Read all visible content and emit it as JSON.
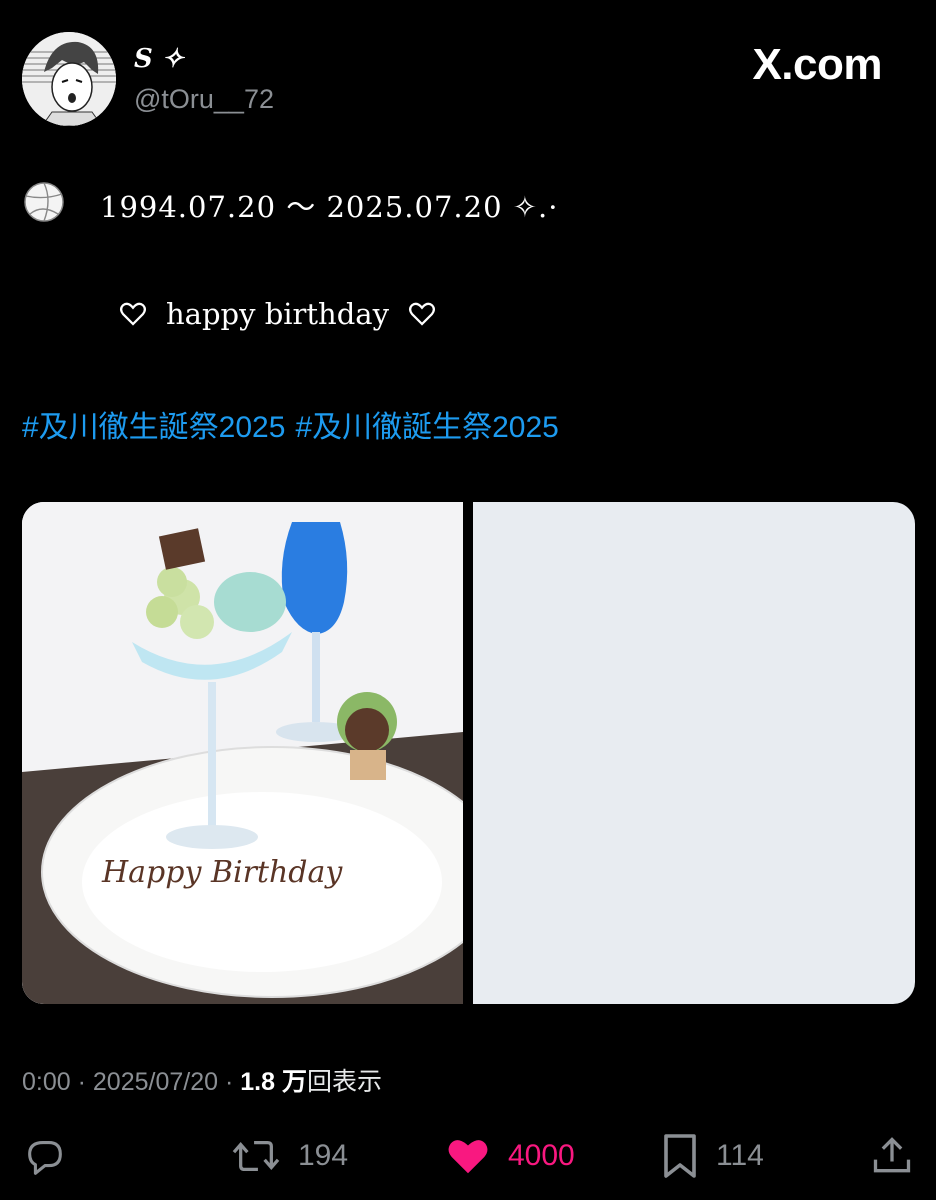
{
  "post": {
    "display_name": "S ✧",
    "handle": "@tOru__72",
    "brand": "X.com",
    "dates_line": "1994.07.20 〜 2025.07.20 ✧.·",
    "birthday_line": "happy birthday",
    "hashtags": [
      "#及川徹生誕祭2025",
      "#及川徹誕生祭2025"
    ],
    "image_text": "Happy Birthday",
    "meta": {
      "time": "0:00",
      "separator": "·",
      "date": "2025/07/20",
      "views_count": "1.8 万",
      "views_label": "回表示"
    },
    "actions": {
      "retweets": "194",
      "likes": "4000",
      "bookmarks": "114"
    }
  },
  "icons": [
    "volleyball-icon",
    "heart-outline-icon",
    "reply-icon",
    "retweet-icon",
    "heart-filled-icon",
    "bookmark-icon",
    "share-icon"
  ],
  "colors": {
    "background": "#000000",
    "hashtag": "#1d9bf0",
    "like": "#f91880",
    "muted": "#8b8f94"
  }
}
